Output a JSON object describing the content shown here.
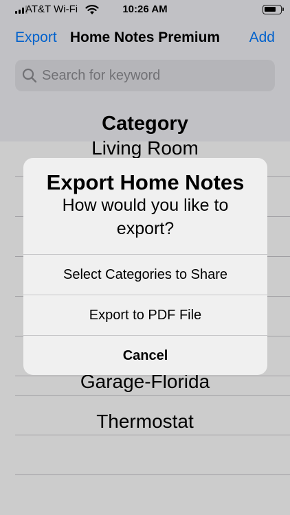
{
  "status_bar": {
    "carrier": "AT&T Wi-Fi",
    "time": "10:26 AM"
  },
  "nav": {
    "left_button": "Export",
    "title": "Home Notes Premium",
    "right_button": "Add"
  },
  "search": {
    "placeholder": "Search for keyword"
  },
  "section": {
    "title": "Category"
  },
  "list": {
    "items": [
      {
        "label": "Living Room"
      },
      {
        "label": ""
      },
      {
        "label": ""
      },
      {
        "label": ""
      },
      {
        "label": ""
      },
      {
        "label": ""
      },
      {
        "label": "Garage-Florida"
      },
      {
        "label": "Thermostat"
      },
      {
        "label": ""
      }
    ]
  },
  "alert": {
    "title": "Export Home Notes",
    "message": "How would you like to export?",
    "buttons": [
      {
        "label": "Select Categories to Share"
      },
      {
        "label": "Export to PDF File"
      },
      {
        "label": "Cancel"
      }
    ]
  },
  "colors": {
    "accent": "#007aff",
    "background": "#f2f2f7",
    "alert_background": "#f0f0f0",
    "separator": "#c8c7cc"
  },
  "icons": [
    "signal-icon",
    "wifi-icon",
    "battery-icon",
    "search-icon"
  ]
}
